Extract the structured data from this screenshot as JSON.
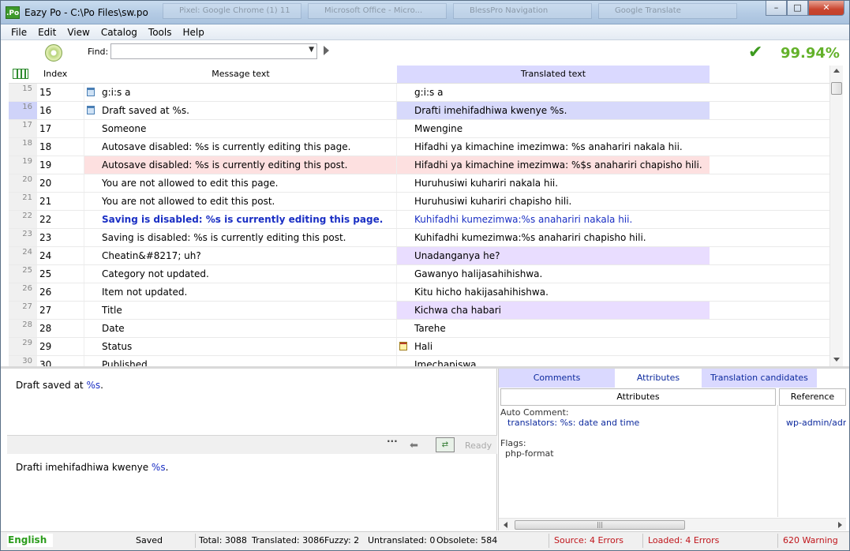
{
  "window": {
    "title": "Eazy Po - C:\\Po Files\\sw.po",
    "app_icon": ".Po",
    "ghost_tabs": [
      "Pixel: Google Chrome (1) 11",
      "Microsoft Office - Micro...",
      "BlessPro Navigation",
      "Google Translate"
    ],
    "controls": {
      "minimize": "–",
      "maximize": "□",
      "close": "✕"
    }
  },
  "menu": [
    "File",
    "Edit",
    "View",
    "Catalog",
    "Tools",
    "Help"
  ],
  "toolbar": {
    "find_label": "Find:",
    "find_value": "",
    "completion": "99.94%",
    "check_icon": "check-icon",
    "colors": {
      "completion": "#63b12a",
      "check": "#3c9a1e"
    }
  },
  "grid": {
    "headers": {
      "index": "Index",
      "message": "Message text",
      "translated": "Translated text"
    },
    "rows": [
      {
        "n": "15",
        "idx": "15",
        "msg": "g:i:s a",
        "tr": "g:i:s a",
        "icon": "doc"
      },
      {
        "n": "16",
        "idx": "16",
        "msg": "Draft saved at %s.",
        "tr": "Drafti imehifadhiwa kwenye %s.",
        "icon": "doc"
      },
      {
        "n": "17",
        "idx": "17",
        "msg": "Someone",
        "tr": "Mwengine"
      },
      {
        "n": "18",
        "idx": "18",
        "msg": "Autosave disabled: %s is currently editing this page.",
        "tr": "Hifadhi ya kimachine imezimwa: %s anahariri nakala hii."
      },
      {
        "n": "19",
        "idx": "19",
        "msg": "Autosave disabled: %s is currently editing this post.",
        "tr": "Hifadhi ya kimachine imezimwa: %$s anahariri chapisho hili."
      },
      {
        "n": "20",
        "idx": "20",
        "msg": "You are not allowed to edit this page.",
        "tr": "Huruhusiwi kuhariri nakala hii."
      },
      {
        "n": "21",
        "idx": "21",
        "msg": "You are not allowed to edit this post.",
        "tr": "Huruhusiwi kuhariri chapisho hili."
      },
      {
        "n": "22",
        "idx": "22",
        "msg": "Saving is disabled: %s is currently editing this page.",
        "tr": "Kuhifadhi kumezimwa:%s anahariri nakala hii."
      },
      {
        "n": "23",
        "idx": "23",
        "msg": "Saving is disabled: %s is currently editing this post.",
        "tr": "Kuhifadhi kumezimwa:%s anahariri chapisho hili."
      },
      {
        "n": "24",
        "idx": "24",
        "msg": "Cheatin&#8217; uh?",
        "tr": "Unadanganya he?"
      },
      {
        "n": "25",
        "idx": "25",
        "msg": "Category not updated.",
        "tr": "Gawanyo halijasahihishwa."
      },
      {
        "n": "26",
        "idx": "26",
        "msg": "Item not updated.",
        "tr": "Kitu hicho hakijasahihishwa."
      },
      {
        "n": "27",
        "idx": "27",
        "msg": "Title",
        "tr": "Kichwa cha habari"
      },
      {
        "n": "28",
        "idx": "28",
        "msg": "Date",
        "tr": "Tarehe"
      },
      {
        "n": "29",
        "idx": "29",
        "msg": "Status",
        "tr": "Hali",
        "tr_icon": "note"
      },
      {
        "n": "30",
        "idx": "30",
        "msg": "Published",
        "tr": "Imechapiswa"
      }
    ],
    "colors": {
      "selected": "#d7d9fb",
      "error": "#fde0e0",
      "fuzzy": "#e9ddff",
      "link": "#1a2fc4"
    }
  },
  "editor": {
    "source_prefix": "Draft saved at ",
    "source_placeholder": "%s",
    "source_suffix": ".",
    "translation_prefix": "Drafti imehifadhiwa kwenye ",
    "translation_placeholder": "%s",
    "translation_suffix": ".",
    "dots": "···",
    "ready": "Ready"
  },
  "panel": {
    "tabs": [
      "Comments",
      "Attributes",
      "Translation candidates"
    ],
    "attributes_header": "Attributes",
    "reference_header": "Reference",
    "auto_comment_label": "Auto Comment:",
    "auto_comment_value": "translators: %s: date and time",
    "flags_label": "Flags:",
    "flags_value": "php-format",
    "reference_value": "wp-admin/admin"
  },
  "status": {
    "language": "English",
    "saved": "Saved",
    "total": "Total: 3088",
    "translated": "Translated: 3086",
    "fuzzy": "Fuzzy: 2",
    "untranslated": "Untranslated: 0",
    "obsolete": "Obsolete: 584",
    "source_errors": "Source: 4 Errors",
    "loaded_errors": "Loaded: 4 Errors",
    "warnings": "620 Warning",
    "colors": {
      "language": "#2c9d1d",
      "error": "#c0151b"
    }
  }
}
